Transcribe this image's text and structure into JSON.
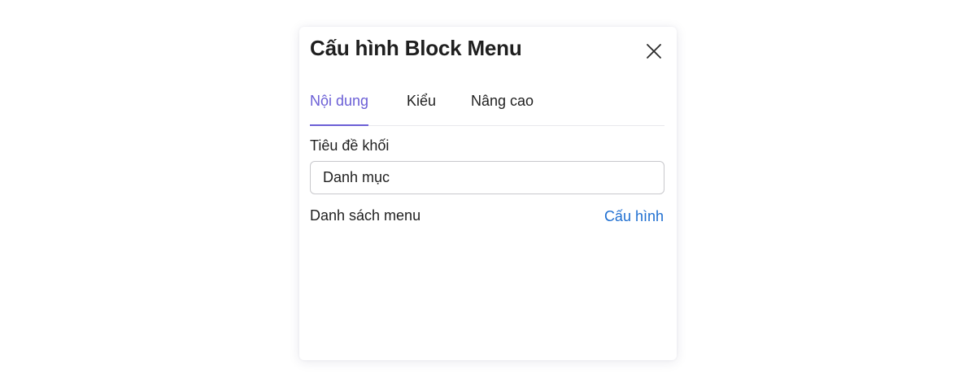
{
  "dialog": {
    "title": "Cấu hình Block Menu"
  },
  "tabs": [
    {
      "label": "Nội dung",
      "active": true
    },
    {
      "label": "Kiểu",
      "active": false
    },
    {
      "label": "Nâng cao",
      "active": false
    }
  ],
  "form": {
    "title_label": "Tiêu đề khối",
    "title_value": "Danh mục",
    "menu_list_label": "Danh sách menu",
    "config_link": "Cấu hình"
  },
  "icons": {
    "close": "close-icon"
  },
  "colors": {
    "accent": "#6b5fd6",
    "link": "#1f6fd1",
    "text": "#1f1f1f",
    "border": "#c8c8cc"
  }
}
